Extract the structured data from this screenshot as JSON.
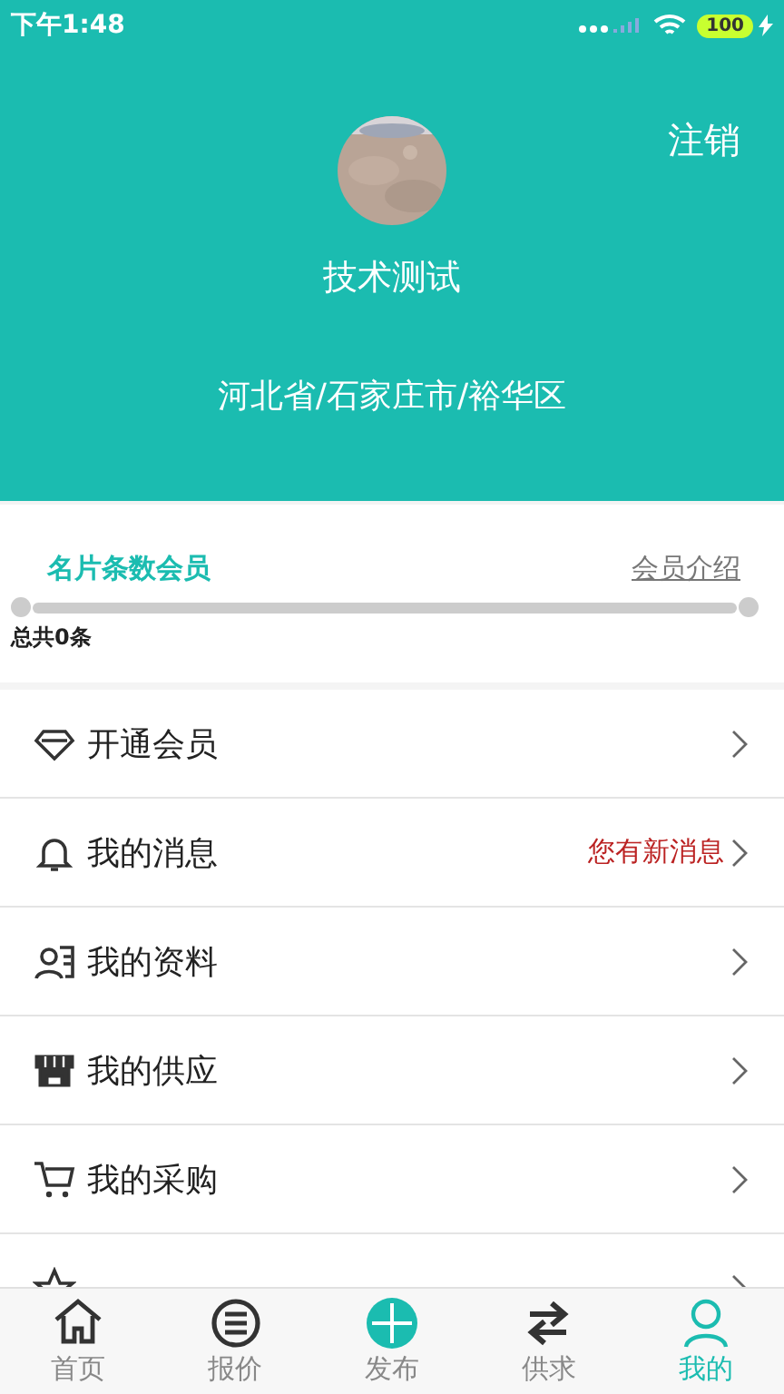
{
  "status_bar": {
    "time": "下午1:48",
    "battery": "100"
  },
  "profile": {
    "logout": "注销",
    "name": "技术测试",
    "region": "河北省/石家庄市/裕华区"
  },
  "membership": {
    "title": "名片条数会员",
    "link": "会员介绍",
    "level": 0,
    "total": "总共0条"
  },
  "menu": [
    {
      "kind": "row",
      "label": "开通会员"
    },
    {
      "kind": "row",
      "label": "我的消息",
      "note": "您有新消息"
    },
    {
      "kind": "row",
      "label": "我的资料"
    },
    {
      "kind": "row",
      "label": "我的供应"
    },
    {
      "kind": "row",
      "label": "我的采购"
    },
    {
      "kind": "cut"
    }
  ],
  "tabs": [
    {
      "label": "首页",
      "selected": false
    },
    {
      "label": "报价",
      "selected": false
    },
    {
      "label": "发布",
      "selected": false
    },
    {
      "label": "供求",
      "selected": false
    },
    {
      "label": "我的",
      "selected": true
    }
  ]
}
